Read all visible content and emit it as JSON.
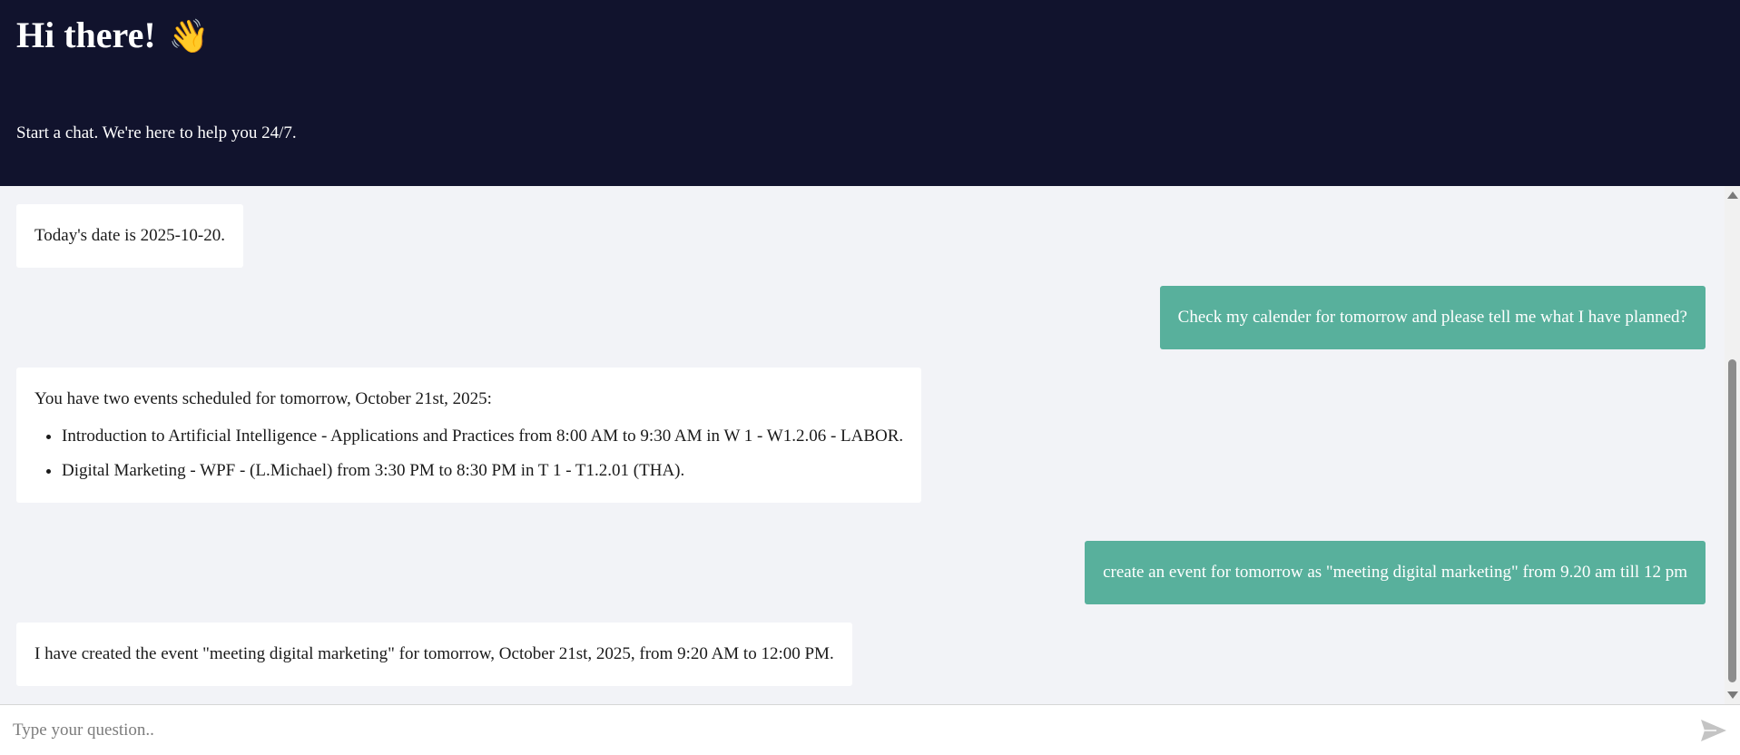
{
  "header": {
    "title": "Hi there!",
    "wave_emoji": "👋",
    "subtitle": "Start a chat. We're here to help you 24/7."
  },
  "messages": [
    {
      "role": "bot",
      "text": "Today's date is 2025-10-20."
    },
    {
      "role": "user",
      "text": "Check my calender for tomorrow and please tell me what I have planned?"
    },
    {
      "role": "bot",
      "text": "You have two events scheduled for tomorrow, October 21st, 2025:",
      "items": [
        "Introduction to Artificial Intelligence - Applications and Practices from 8:00 AM to 9:30 AM in W 1 - W1.2.06 - LABOR.",
        "Digital Marketing - WPF - (L.Michael) from 3:30 PM to 8:30 PM in T 1 - T1.2.01 (THA)."
      ]
    },
    {
      "role": "user",
      "text": "create an event for tomorrow as \"meeting digital marketing\" from 9.20 am till 12 pm"
    },
    {
      "role": "bot",
      "text": "I have created the event \"meeting digital marketing\" for tomorrow, October 21st, 2025, from 9:20 AM to 12:00 PM."
    }
  ],
  "input": {
    "placeholder": "Type your question..",
    "value": ""
  },
  "icons": {
    "send": "send-icon",
    "scroll_up": "scroll-up-arrow",
    "scroll_down": "scroll-down-arrow"
  },
  "colors": {
    "header_bg": "#11132d",
    "user_bubble": "#58b09c",
    "bot_bubble": "#ffffff",
    "chat_bg": "#f2f3f7"
  }
}
